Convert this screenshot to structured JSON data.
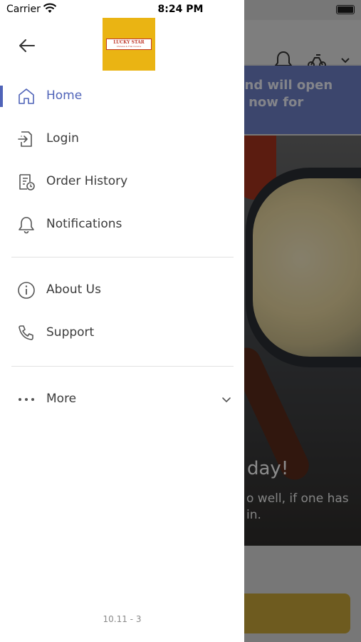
{
  "status_bar": {
    "carrier": "Carrier",
    "time": "8:24 PM"
  },
  "brand": {
    "logo_line1": "LUCKY STAR",
    "logo_line2": "Chinese & Thai Cuisine",
    "logo_bg": "#eab413"
  },
  "accent_color": "#4f63b8",
  "menu": {
    "primary": [
      {
        "label": "Home",
        "icon": "home-icon",
        "active": true
      },
      {
        "label": "Login",
        "icon": "login-icon"
      },
      {
        "label": "Order History",
        "icon": "order-history-icon"
      },
      {
        "label": "Notifications",
        "icon": "bell-icon"
      }
    ],
    "secondary": [
      {
        "label": "About Us",
        "icon": "info-icon"
      },
      {
        "label": "Support",
        "icon": "phone-icon"
      }
    ],
    "more": {
      "label": "More",
      "icon": "more-dots-icon"
    }
  },
  "background": {
    "banner_text": "ed and will open\nrder now for",
    "hero_title": "day!",
    "hero_subtitle": "o well, if one has\nin."
  },
  "version": "10.11 - 3"
}
